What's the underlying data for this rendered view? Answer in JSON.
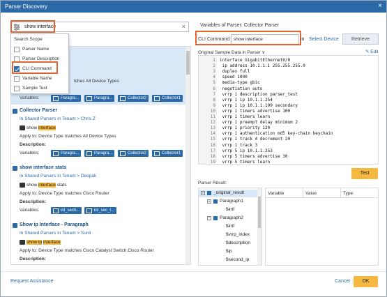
{
  "window": {
    "title": "Parser Discovery",
    "close": "×"
  },
  "search": {
    "value": "show interface",
    "clear": "×"
  },
  "scope": {
    "header": "Search Scope",
    "options": [
      {
        "label": "Parser Name",
        "checked": false
      },
      {
        "label": "Parser Description",
        "checked": false
      },
      {
        "label": "CLI Command",
        "checked": true
      },
      {
        "label": "Variable Name",
        "checked": false
      },
      {
        "label": "Sample Text",
        "checked": false
      }
    ]
  },
  "cards": [
    {
      "apply_partial": "tches All Device Types",
      "vars_label": "Variables:",
      "chips": [
        "Paragra...",
        "Paragra...",
        "Collector2",
        "Collector1"
      ]
    },
    {
      "name": "Collector Parser",
      "path": "In Shared Parsers in Tenant > Chris Z",
      "cmd_pre": "show ",
      "cmd_mark": "interface",
      "cmd_post": "",
      "apply": "Apply to:  Device Type matches All Device Types",
      "desc": "Description:",
      "vars_label": "Variables:",
      "chips": [
        "Paragra...",
        "Paragra...",
        "Collector2",
        "Collector1"
      ]
    },
    {
      "name": "show interface stats",
      "path": "In Shared Parsers in Tenant > Deepak",
      "cmd_pre": "show ",
      "cmd_mark": "interface",
      "cmd_post": " stats",
      "apply": "Apply to:  Device Type matches Cisco Router",
      "desc": "Description:",
      "vars_label": "Variables:",
      "chips": [
        "int_secti...",
        "int_sec_t..."
      ]
    },
    {
      "name": "Show ip Interface - Paragraph",
      "path": "In Shared Parsers in Tenant > Sunil",
      "cmd_pre": "show ",
      "cmd_mark": "ip",
      "cmd_post": " interface",
      "cmd_mark2": "interface",
      "apply": "Apply to:  Device Type matches Cisco Catalyst Switch,Cisco Router",
      "desc": "Description:"
    }
  ],
  "right": {
    "title": "Variables of Parser: Collector Parser",
    "cli_label": "CLI Command:",
    "cli_value": "show interface",
    "in_label": "in",
    "select_device": "Select Device",
    "retrieve": "Retrieve",
    "sample_label": "Original Sample Data in Parser ∨",
    "edit": "Edit",
    "code_lines": [
      "interface GigabitEthernet0/0",
      " ip address 10.1.1.1 255.255.255.0",
      " duplex full",
      " speed 1000",
      " media-type gbic",
      " negotiation auto",
      " vrrp 1 description parser_test",
      " vrrp 1 ip 10.1.1.254",
      " vrrp 1 ip 10.1.1.199 secondary",
      " vrrp 1 timers advertise 100",
      " vrrp 1 timers learn",
      " vrrp 1 preempt delay minimum 2",
      " vrrp 1 priority 120",
      " vrrp 1 authentication md5 key-chain keychain",
      " vrrp 1 track 4 decrement 20",
      " vrrp 1 track 3",
      " vrrp 5 ip 10.1.1.253",
      " vrrp 5 timers advertise 30",
      " vrrp 5 timers learn"
    ],
    "test": "Test",
    "result_label": "Parser Result:",
    "tree": [
      {
        "label": "_original_result",
        "level": 0,
        "toggle": "−",
        "check": true,
        "selected": true
      },
      {
        "label": "Paragraph1",
        "level": 1,
        "toggle": "+",
        "check": true
      },
      {
        "label": "$intf",
        "level": 2
      },
      {
        "label": "Paragraph2",
        "level": 1,
        "toggle": "−",
        "check": true
      },
      {
        "label": "$intf",
        "level": 2
      },
      {
        "label": "$vrrp_index",
        "level": 2
      },
      {
        "label": "$description",
        "level": 2
      },
      {
        "label": "$ip",
        "level": 2
      },
      {
        "label": "$second_ip",
        "level": 2
      }
    ],
    "table_headers": [
      "Variable",
      "Value",
      "Type"
    ]
  },
  "footer": {
    "request": "Request Assistance",
    "cancel": "Cancel",
    "ok": "OK"
  },
  "colors": {
    "accent": "#2b6aa6",
    "highlight": "#e3642f",
    "button": "#f5b942"
  }
}
